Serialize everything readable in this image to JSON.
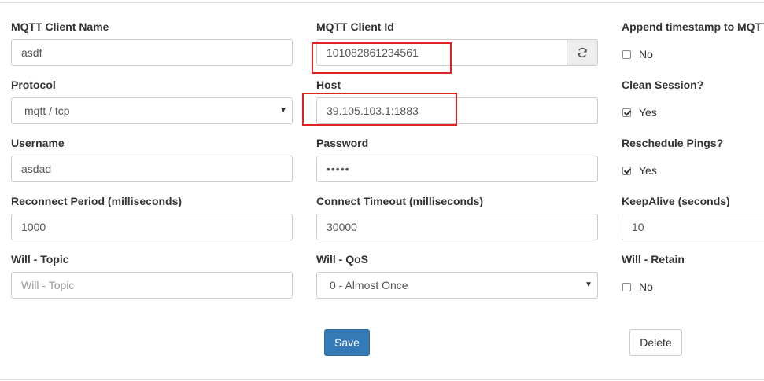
{
  "form": {
    "client_name": {
      "label": "MQTT Client Name",
      "value": "asdf"
    },
    "client_id": {
      "label": "MQTT Client Id",
      "value": "101082861234561"
    },
    "append_timestamp": {
      "label": "Append timestamp to MQTT",
      "checked": false,
      "text": "No"
    },
    "protocol": {
      "label": "Protocol",
      "selected": "mqtt / tcp"
    },
    "host": {
      "label": "Host",
      "value": "39.105.103.1:1883"
    },
    "clean_session": {
      "label": "Clean Session?",
      "checked": true,
      "text": "Yes"
    },
    "username": {
      "label": "Username",
      "value": "asdad"
    },
    "password": {
      "label": "Password",
      "value": "•••••"
    },
    "reschedule_pings": {
      "label": "Reschedule Pings?",
      "checked": true,
      "text": "Yes"
    },
    "reconnect_period": {
      "label": "Reconnect Period (milliseconds)",
      "value": "1000"
    },
    "connect_timeout": {
      "label": "Connect Timeout (milliseconds)",
      "value": "30000"
    },
    "keepalive": {
      "label": "KeepAlive (seconds)",
      "value": "10"
    },
    "will_topic": {
      "label": "Will - Topic",
      "value": "",
      "placeholder": "Will - Topic"
    },
    "will_qos": {
      "label": "Will - QoS",
      "selected": "0 - Almost Once"
    },
    "will_retain": {
      "label": "Will - Retain",
      "checked": false,
      "text": "No"
    }
  },
  "actions": {
    "save_label": "Save",
    "delete_label": "Delete"
  },
  "icons": {
    "refresh": "refresh-icon",
    "caret": "caret-down-icon"
  },
  "colors": {
    "primary": "#337ab7",
    "highlight": "#e22222"
  }
}
